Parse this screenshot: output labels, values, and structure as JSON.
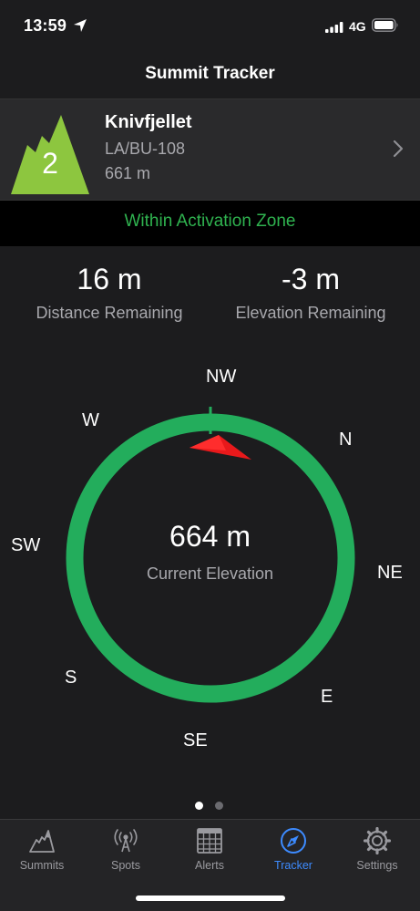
{
  "status_bar": {
    "time": "13:59",
    "network": "4G"
  },
  "nav": {
    "title": "Summit Tracker"
  },
  "summit": {
    "points": "2",
    "name": "Knivfjellet",
    "reference": "LA/BU-108",
    "altitude": "661 m",
    "icon": "mountain-icon",
    "badge_color": "#8dc63f"
  },
  "zone": {
    "status": "Within Activation Zone",
    "color": "#2fb24f"
  },
  "stats": {
    "distance_value": "16 m",
    "distance_label": "Distance Remaining",
    "elevation_value": "-3 m",
    "elevation_label": "Elevation Remaining"
  },
  "compass": {
    "directions": {
      "nw": "NW",
      "n": "N",
      "ne": "NE",
      "e": "E",
      "se": "SE",
      "s": "S",
      "sw": "SW",
      "w": "W"
    },
    "current_elevation_value": "664 m",
    "current_elevation_label": "Current Elevation",
    "ring_color": "#23ad5c",
    "pointer_color": "#e8191b"
  },
  "pager": {
    "total": 2,
    "current": 1
  },
  "tabs": [
    {
      "label": "Summits",
      "icon": "mountain-icon",
      "active": false
    },
    {
      "label": "Spots",
      "icon": "antenna-icon",
      "active": false
    },
    {
      "label": "Alerts",
      "icon": "calendar-icon",
      "active": false
    },
    {
      "label": "Tracker",
      "icon": "compass-icon",
      "active": true
    },
    {
      "label": "Settings",
      "icon": "gear-icon",
      "active": false
    }
  ],
  "colors": {
    "accent": "#3d8bff",
    "background": "#1c1c1e"
  }
}
